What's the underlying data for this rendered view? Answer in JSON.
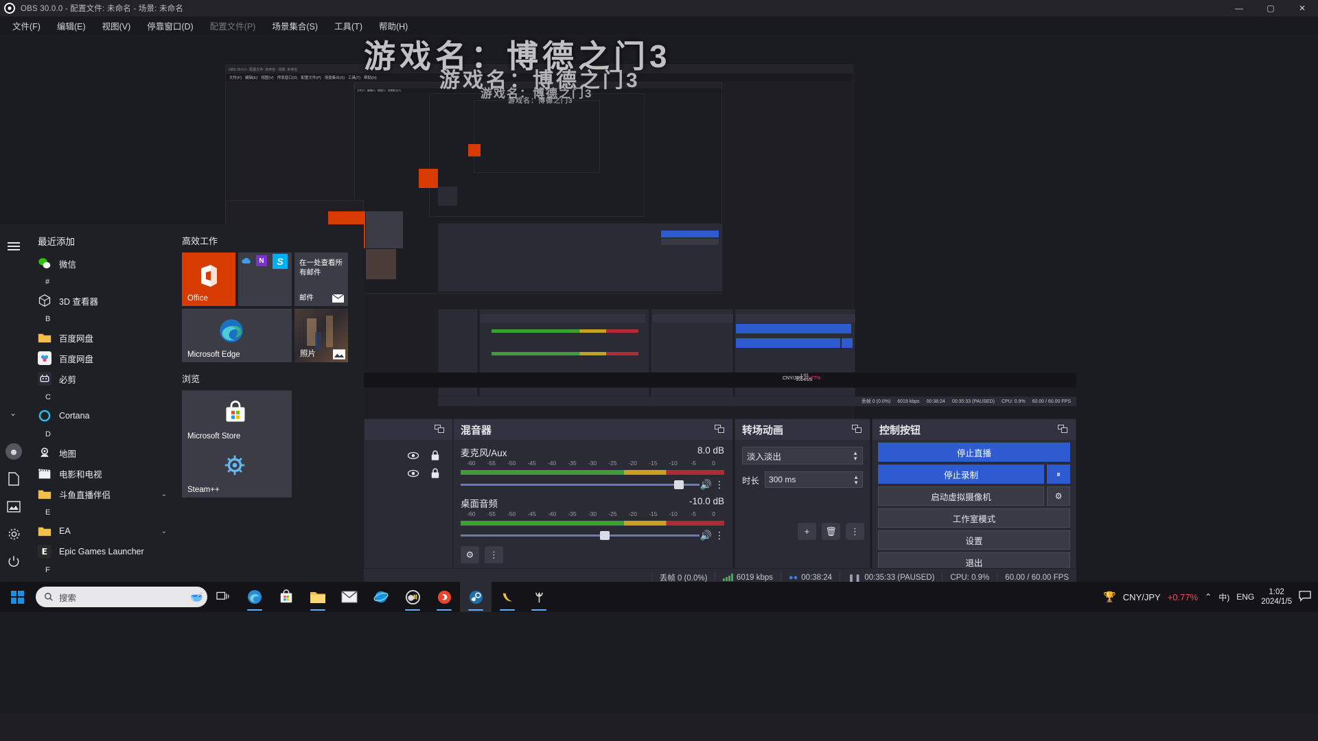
{
  "obs": {
    "title": "OBS 30.0.0 - 配置文件: 未命名 - 场景: 未命名",
    "window_buttons": {
      "minimize": "—",
      "maximize": "▢",
      "close": "✕"
    },
    "menu": [
      {
        "label": "文件(F)",
        "dim": false
      },
      {
        "label": "编辑(E)",
        "dim": false
      },
      {
        "label": "视图(V)",
        "dim": false
      },
      {
        "label": "停靠窗口(D)",
        "dim": false
      },
      {
        "label": "配置文件(P)",
        "dim": true
      },
      {
        "label": "场景集合(S)",
        "dim": false
      },
      {
        "label": "工具(T)",
        "dim": false
      },
      {
        "label": "帮助(H)",
        "dim": false
      }
    ],
    "overlay_title": "游戏名：博德之门3",
    "sources_dock": {
      "title": ""
    },
    "mixer": {
      "title": "混音器",
      "channels": [
        {
          "name": "麦克风/Aux",
          "db": "8.0 dB",
          "ticks": [
            "-60",
            "-55",
            "-50",
            "-45",
            "-40",
            "-35",
            "-30",
            "-25",
            "-20",
            "-15",
            "-10",
            "-5",
            "0"
          ],
          "slider_pct": 92
        },
        {
          "name": "桌面音频",
          "db": "-10.0 dB",
          "ticks": [
            "-60",
            "-55",
            "-50",
            "-45",
            "-40",
            "-35",
            "-30",
            "-25",
            "-20",
            "-15",
            "-10",
            "-5",
            "0"
          ],
          "slider_pct": 60
        }
      ],
      "settings_icon": "audio-mixer-settings-icon",
      "kebab_icon": "kebab-menu-icon"
    },
    "transitions": {
      "title": "转场动画",
      "selected": "淡入淡出",
      "duration_label": "时长",
      "duration_value": "300 ms",
      "add_label": "+",
      "remove_label": "🗑",
      "props_label": "⋮"
    },
    "controls": {
      "title": "控制按钮",
      "buttons": [
        {
          "label": "停止直播",
          "style": "blue"
        },
        {
          "label": "停止录制",
          "style": "blue",
          "side": "⏸"
        },
        {
          "label": "启动虚拟摄像机",
          "style": "normal",
          "side": "⚙"
        },
        {
          "label": "工作室模式",
          "style": "normal"
        },
        {
          "label": "设置",
          "style": "normal"
        },
        {
          "label": "退出",
          "style": "normal"
        }
      ]
    },
    "status": {
      "dropped": "丢帧 0 (0.0%)",
      "bitrate": "6019 kbps",
      "stream_time": "00:38:24",
      "record_time": "00:35:33 (PAUSED)",
      "cpu": "CPU: 0.9%",
      "fps": "60.00 / 60.00 FPS"
    }
  },
  "start": {
    "section_title": "最近添加",
    "left_icons": [
      {
        "name": "hamburger-icon",
        "glyph": ""
      },
      {
        "name": "user-avatar-icon",
        "glyph": "👤"
      },
      {
        "name": "documents-icon",
        "glyph": "🗎"
      },
      {
        "name": "pictures-icon",
        "glyph": "🖼"
      },
      {
        "name": "settings-gear-icon",
        "glyph": "⚙"
      },
      {
        "name": "power-icon",
        "glyph": "⏻"
      }
    ],
    "apps": [
      {
        "type": "app",
        "label": "微信",
        "icon": "wechat-icon"
      },
      {
        "type": "letter",
        "label": "#"
      },
      {
        "type": "app",
        "label": "3D 查看器",
        "icon": "3d-viewer-icon"
      },
      {
        "type": "letter",
        "label": "B"
      },
      {
        "type": "app",
        "label": "百度网盘",
        "icon": "folder-icon"
      },
      {
        "type": "app",
        "label": "百度网盘",
        "icon": "baidu-netdisk-icon"
      },
      {
        "type": "app",
        "label": "必剪",
        "icon": "bijian-icon"
      },
      {
        "type": "letter",
        "label": "C"
      },
      {
        "type": "app",
        "label": "Cortana",
        "icon": "cortana-icon"
      },
      {
        "type": "letter",
        "label": "D"
      },
      {
        "type": "app",
        "label": "地图",
        "icon": "maps-icon"
      },
      {
        "type": "app",
        "label": "电影和电视",
        "icon": "movies-tv-icon"
      },
      {
        "type": "app",
        "label": "斗鱼直播伴侣",
        "icon": "folder-icon",
        "chevron": "⌄"
      },
      {
        "type": "letter",
        "label": "E"
      },
      {
        "type": "app",
        "label": "EA",
        "icon": "folder-icon",
        "chevron": "⌄"
      },
      {
        "type": "app",
        "label": "Epic Games Launcher",
        "icon": "epic-icon"
      },
      {
        "type": "letter",
        "label": "F"
      }
    ],
    "tile_groups": [
      {
        "title": "高效工作",
        "tiles": [
          {
            "label": "Office",
            "kind": "office",
            "size": "lg"
          },
          {
            "label": "",
            "kind": "msapps",
            "size": "lg"
          },
          {
            "label": "在一处查看所有邮件",
            "kind": "mail",
            "size": "lg",
            "sublabel": "邮件"
          },
          {
            "label": "Microsoft Edge",
            "kind": "edge",
            "size": "wide"
          },
          {
            "label": "照片",
            "kind": "photos",
            "size": "lg"
          }
        ]
      },
      {
        "title": "浏览",
        "tiles": [
          {
            "label": "Microsoft Store",
            "kind": "store",
            "size": "wide"
          },
          {
            "label": "Steam++",
            "kind": "steampp",
            "size": "wide"
          }
        ]
      }
    ]
  },
  "taskbar": {
    "start_name": "start-button",
    "search_placeholder": "搜索",
    "task_view": "task-view-icon",
    "pinned": [
      {
        "name": "edge-icon",
        "active": false,
        "open": true
      },
      {
        "name": "store-icon",
        "active": false,
        "open": false
      },
      {
        "name": "file-explorer-icon",
        "active": false,
        "open": true
      },
      {
        "name": "mail-icon",
        "active": false,
        "open": false
      },
      {
        "name": "ie-icon",
        "active": false,
        "open": false
      },
      {
        "name": "obs-icon",
        "active": false,
        "open": true
      },
      {
        "name": "douyu-icon",
        "active": false,
        "open": true
      },
      {
        "name": "steam-icon",
        "active": true,
        "open": true
      },
      {
        "name": "banana-icon",
        "active": false,
        "open": true
      },
      {
        "name": "game-icon",
        "active": false,
        "open": true
      }
    ],
    "tray": {
      "ticker_symbol": "CNY/JPY",
      "ticker_change": "+0.77%",
      "chevron": "⌃",
      "ime": "中)",
      "lang": "ENG",
      "time": "1:02",
      "date": "2024/1/5",
      "action_center": "action-center-icon"
    }
  }
}
